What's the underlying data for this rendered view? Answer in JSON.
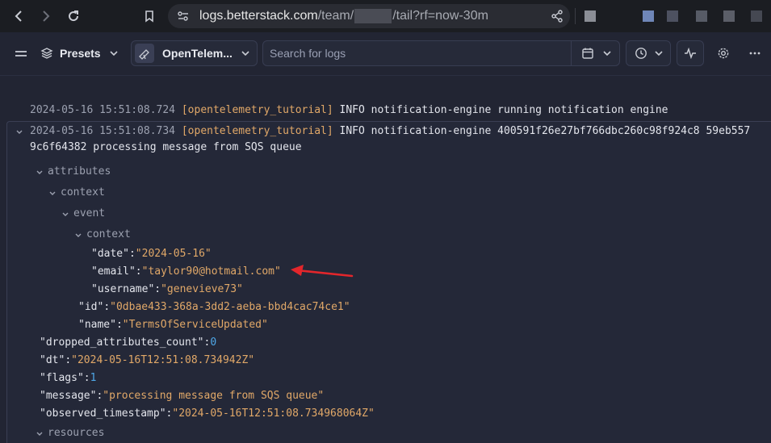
{
  "browser": {
    "url_host": "logs.betterstack.com",
    "url_path1": "/team/",
    "url_path2": "/tail?rf=now-30m"
  },
  "toolbar": {
    "presets_label": "Presets",
    "source_label": "OpenTelem...",
    "search_placeholder": "Search for logs"
  },
  "logs": {
    "row1": {
      "timestamp": "2024-05-16 15:51:08.724",
      "source": "[opentelemetry_tutorial]",
      "message": "INFO notification-engine running notification engine"
    },
    "row2": {
      "timestamp": "2024-05-16 15:51:08.734",
      "source": "[opentelemetry_tutorial]",
      "message_line1": "INFO notification-engine 400591f26e27bf766dbc260c98f924c8 59eb557",
      "message_line2": "9c6f64382 processing message from SQS queue"
    }
  },
  "tree": {
    "attributes": "attributes",
    "context1": "context",
    "event": "event",
    "context2": "context",
    "date_key": "\"date\"",
    "date_val": "\"2024-05-16\"",
    "email_key": "\"email\"",
    "email_val": "\"taylor90@hotmail.com\"",
    "username_key": "\"username\"",
    "username_val": "\"genevieve73\"",
    "id_key": "\"id\"",
    "id_val": "\"0dbae433-368a-3dd2-aeba-bbd4cac74ce1\"",
    "name_key": "\"name\"",
    "name_val": "\"TermsOfServiceUpdated\"",
    "dropped_key": "\"dropped_attributes_count\"",
    "dropped_val": "0",
    "dt_key": "\"dt\"",
    "dt_val": "\"2024-05-16T12:51:08.734942Z\"",
    "flags_key": "\"flags\"",
    "flags_val": "1",
    "message_key": "\"message\"",
    "message_val": "\"processing message from SQS queue\"",
    "observed_key": "\"observed_timestamp\"",
    "observed_val": "\"2024-05-16T12:51:08.734968064Z\"",
    "resources": "resources"
  },
  "colors": {
    "annotation_arrow": "#e3262b",
    "string_value": "#e1a868",
    "number_value": "#4fa8e8"
  }
}
